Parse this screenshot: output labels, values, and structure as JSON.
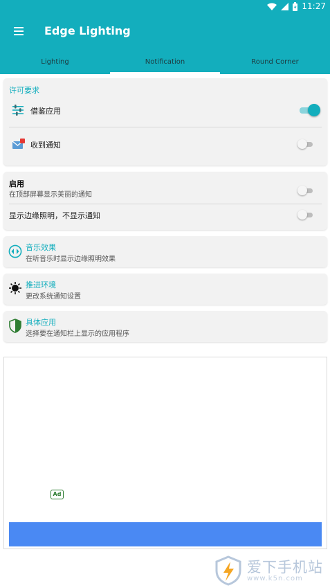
{
  "status_bar": {
    "time": "11:27",
    "icons": [
      "wifi-icon",
      "signal-icon",
      "battery-icon"
    ]
  },
  "app_bar": {
    "title": "Edge Lighting",
    "menu_icon": "menu-icon"
  },
  "tabs": [
    {
      "label": "Lighting",
      "active": false
    },
    {
      "label": "Notification",
      "active": true
    },
    {
      "label": "Round Corner",
      "active": false
    }
  ],
  "permissions": {
    "header": "许可要求",
    "items": [
      {
        "label": "借鉴应用",
        "icon": "sliders-icon",
        "enabled": true
      },
      {
        "label": "收到通知",
        "icon": "mail-notification-icon",
        "enabled": false
      }
    ]
  },
  "display": {
    "enable_title": "启用",
    "enable_subtitle": "在顶部屏幕显示美丽的通知",
    "enable_on": false,
    "edge_only_label": "显示边缘照明，不显示通知",
    "edge_only_on": false
  },
  "nav_items": [
    {
      "title": "音乐效果",
      "subtitle": "在听音乐时显示边缘照明效果",
      "icon": "music-effect-icon"
    },
    {
      "title": "推进环境",
      "subtitle": "更改系统通知设置",
      "icon": "brightness-icon"
    },
    {
      "title": "具体应用",
      "subtitle": "选择要在通知栏上显示的应用程序",
      "icon": "shield-icon"
    }
  ],
  "ad": {
    "badge": "Ad"
  },
  "watermark": {
    "text": "爱下手机站",
    "sub": "www.k5n.com"
  },
  "colors": {
    "primary": "#13aebd",
    "card": "#f2f2f2",
    "ad_button": "#4a89f3"
  }
}
